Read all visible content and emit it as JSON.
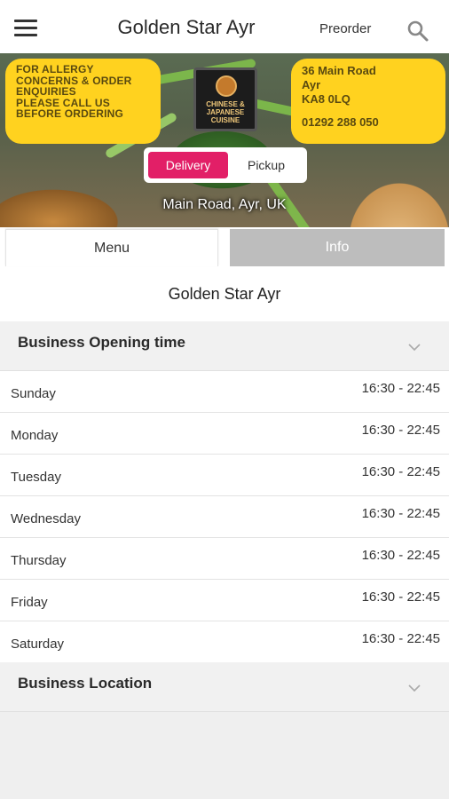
{
  "header": {
    "title": "Golden Star Ayr",
    "preorder_label": "Preorder"
  },
  "banner": {
    "allergy_note": [
      "FOR ALLERGY",
      "CONCERNS & ORDER",
      "ENQUIRIES",
      "PLEASE CALL US",
      "BEFORE ORDERING"
    ],
    "address_lines": [
      "36 Main Road",
      "Ayr",
      "KA8 0LQ"
    ],
    "phone": "01292 288 050",
    "logo_text": [
      "CHINESE &",
      "JAPANESE",
      "CUISINE"
    ],
    "toggle": {
      "delivery": "Delivery",
      "pickup": "Pickup",
      "selected": "Delivery"
    },
    "location": "Main Road, Ayr, UK"
  },
  "tabs": {
    "menu": "Menu",
    "info": "Info",
    "active": "Info"
  },
  "info": {
    "restaurant_name": "Golden Star Ayr",
    "opening_section": "Business Opening time",
    "location_section": "Business Location",
    "hours": [
      {
        "day": "Sunday",
        "time": "16:30 - 22:45"
      },
      {
        "day": "Monday",
        "time": "16:30 - 22:45"
      },
      {
        "day": "Tuesday",
        "time": "16:30 - 22:45"
      },
      {
        "day": "Wednesday",
        "time": "16:30 - 22:45"
      },
      {
        "day": "Thursday",
        "time": "16:30 - 22:45"
      },
      {
        "day": "Friday",
        "time": "16:30 - 22:45"
      },
      {
        "day": "Saturday",
        "time": "16:30 - 22:45"
      }
    ]
  },
  "colors": {
    "accent": "#e21f67",
    "banner_note": "#ffd21f",
    "inactive_tab": "#bdbdbd"
  },
  "icons": [
    "menu-icon",
    "search-icon",
    "chevron-down-icon"
  ]
}
